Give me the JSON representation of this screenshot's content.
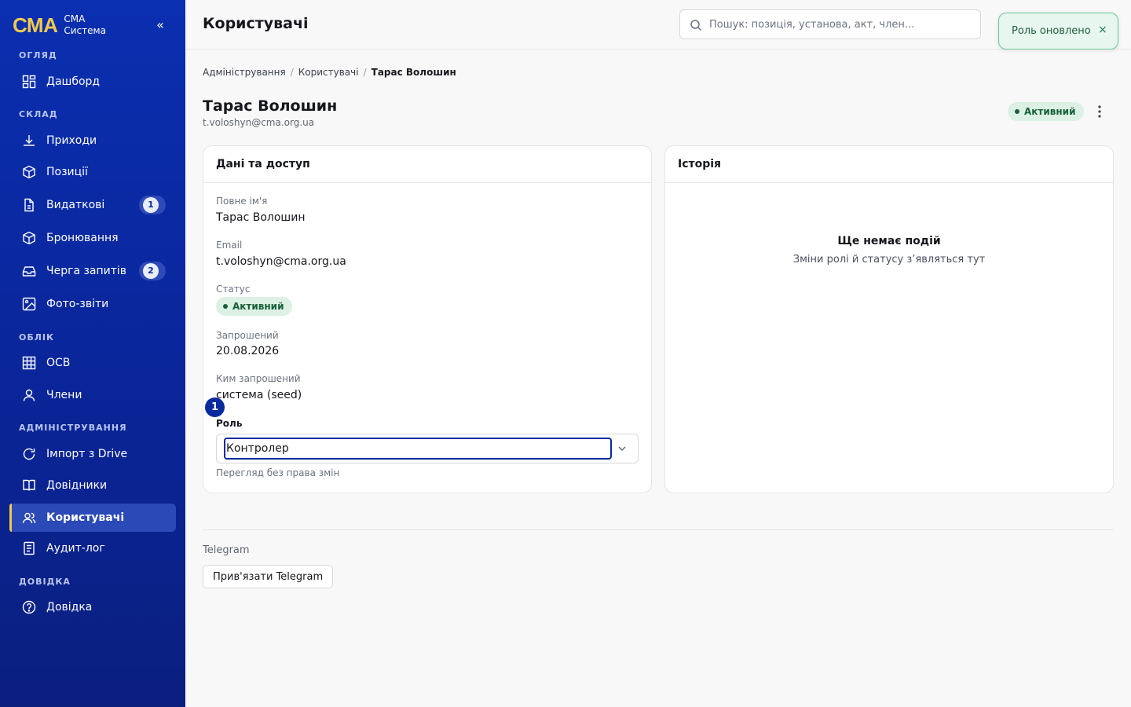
{
  "brand": {
    "logo": "СМА",
    "line1": "СМА",
    "line2": "Система",
    "collapse_icon": "«"
  },
  "sidebar": {
    "sections": {
      "overview": "ОГЛЯД",
      "warehouse": "СКЛАД",
      "accounting": "ОБЛІК",
      "admin": "АДМІНІСТРУВАННЯ",
      "help": "ДОВІДКА"
    },
    "items": [
      {
        "label": "Дашборд",
        "icon": "dashboard-icon"
      },
      {
        "label": "Приходи",
        "icon": "download-icon"
      },
      {
        "label": "Позиції",
        "icon": "box-icon"
      },
      {
        "label": "Видаткові",
        "icon": "document-icon",
        "badge": "1"
      },
      {
        "label": "Бронювання",
        "icon": "box-icon"
      },
      {
        "label": "Черга запитів",
        "icon": "inbox-icon",
        "badge": "2"
      },
      {
        "label": "Фото-звіти",
        "icon": "image-icon"
      },
      {
        "label": "ОСВ",
        "icon": "grid-icon"
      },
      {
        "label": "Члени",
        "icon": "user-icon"
      },
      {
        "label": "Імпорт з Drive",
        "icon": "refresh-icon"
      },
      {
        "label": "Довідники",
        "icon": "book-icon"
      },
      {
        "label": "Користувачі",
        "icon": "users-icon",
        "active": true
      },
      {
        "label": "Аудит-лог",
        "icon": "list-icon"
      },
      {
        "label": "Довідка",
        "icon": "help-icon"
      }
    ]
  },
  "header": {
    "title": "Користувачі",
    "search_placeholder": "Пошук: позиція, установа, акт, член..."
  },
  "toast": {
    "text": "Роль оновлено",
    "close": "×"
  },
  "breadcrumb": [
    "Адміністрування",
    "Користувачі",
    "Тарас Волошин"
  ],
  "user": {
    "name": "Тарас Волошин",
    "email": "t.voloshyn@cma.org.ua",
    "status": "Активний"
  },
  "details_card": {
    "title": "Дані та доступ",
    "full_name_label": "Повне ім'я",
    "full_name": "Тарас Волошин",
    "email_label": "Email",
    "email": "t.voloshyn@cma.org.ua",
    "status_label": "Статус",
    "status": "Активний",
    "invited_label": "Запрошений",
    "invited_date": "20.08.2026",
    "invited_by_label": "Ким запрошений",
    "invited_by": "система (seed)",
    "marker": "1",
    "role_label": "Роль",
    "role_value": "Контролер",
    "role_help": "Перегляд без права змін"
  },
  "history_card": {
    "title": "Історія",
    "empty_title": "Ще немає подій",
    "empty_sub": "Зміни ролі й статусу з’являться тут"
  },
  "telegram": {
    "label": "Telegram",
    "button": "Прив'язати Telegram"
  },
  "colors": {
    "accent": "#0a2a9e",
    "brand_yellow": "#f2c94c",
    "success": "#17603b"
  }
}
